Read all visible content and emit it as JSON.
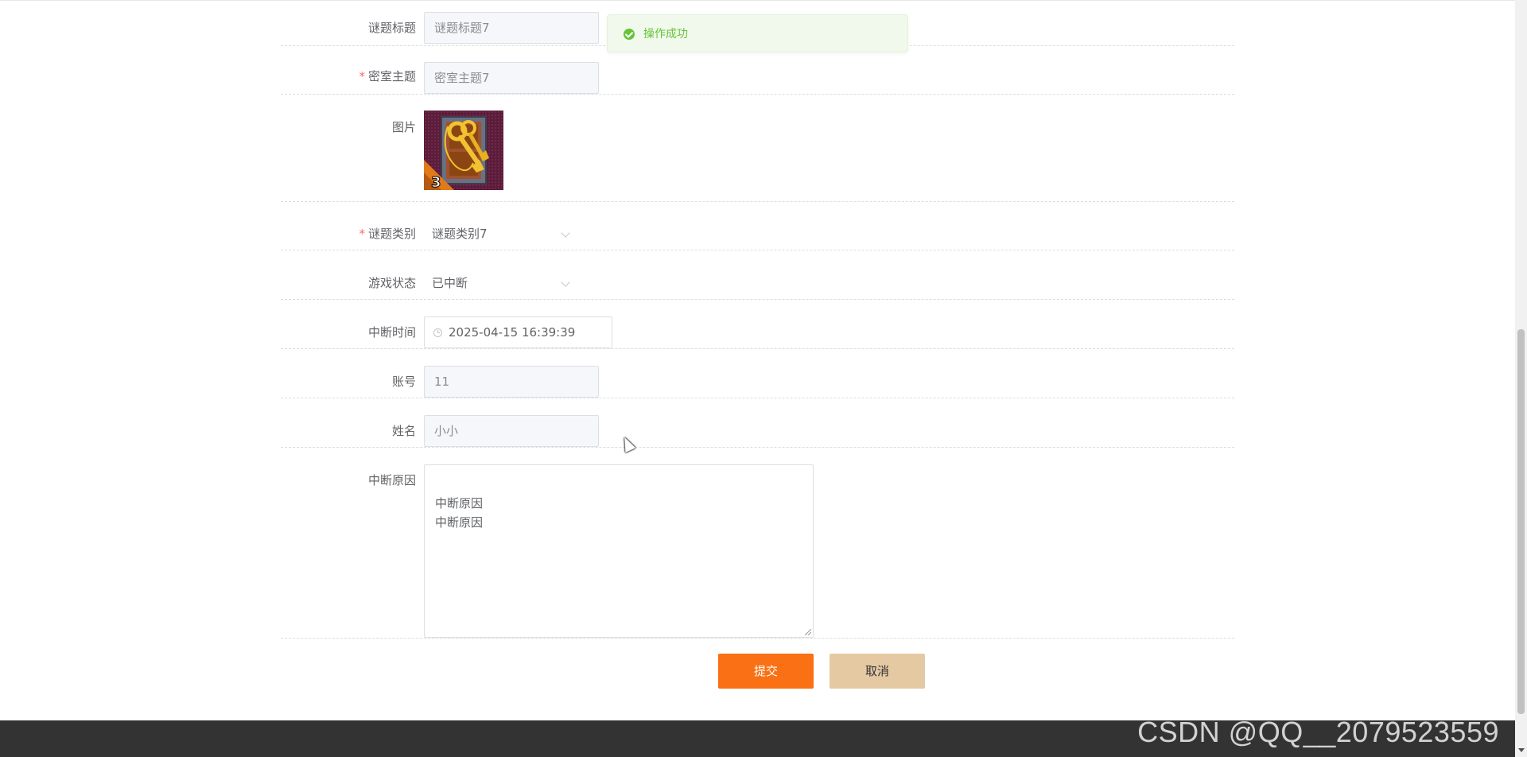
{
  "toast": {
    "message": "操作成功",
    "icon": "success-check-icon",
    "color": "#67c23a"
  },
  "form": {
    "puzzle_title": {
      "label": "谜题标题",
      "value": "谜题标题7",
      "required": false
    },
    "room_theme": {
      "label": "密室主题",
      "value": "密室主题7",
      "required": true
    },
    "image": {
      "label": "图片",
      "badge": "3"
    },
    "puzzle_category": {
      "label": "谜题类别",
      "value": "谜题类别7",
      "required": true
    },
    "game_status": {
      "label": "游戏状态",
      "value": "已中断"
    },
    "interrupt_time": {
      "label": "中断时间",
      "value": "2025-04-15 16:39:39"
    },
    "account": {
      "label": "账号",
      "value": "11"
    },
    "name": {
      "label": "姓名",
      "value": "小小"
    },
    "interrupt_reason": {
      "label": "中断原因",
      "value": "中断原因\n中断原因"
    },
    "required_mark": "*"
  },
  "actions": {
    "submit_label": "提交",
    "cancel_label": "取消",
    "submit_color": "#fa7014",
    "cancel_color": "#e4c9a2"
  },
  "footer": {
    "watermark": "CSDN @QQ__2079523559",
    "background": "#333333"
  }
}
